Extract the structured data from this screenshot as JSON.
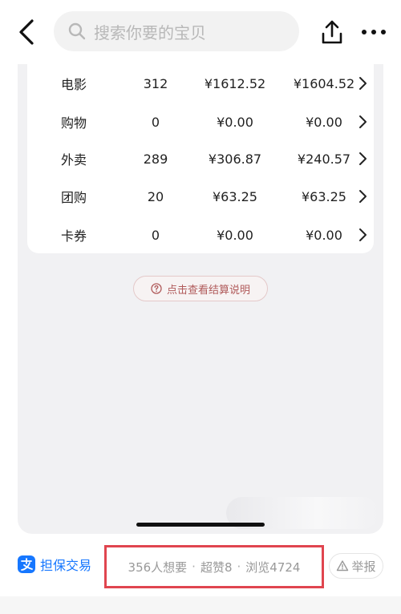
{
  "header": {
    "search_placeholder": "搜索你要的宝贝"
  },
  "table": {
    "rows": [
      {
        "name": "电影",
        "count": "312",
        "amount_a": "¥1612.52",
        "amount_b": "¥1604.52"
      },
      {
        "name": "购物",
        "count": "0",
        "amount_a": "¥0.00",
        "amount_b": "¥0.00"
      },
      {
        "name": "外卖",
        "count": "289",
        "amount_a": "¥306.87",
        "amount_b": "¥240.57"
      },
      {
        "name": "团购",
        "count": "20",
        "amount_a": "¥63.25",
        "amount_b": "¥63.25"
      },
      {
        "name": "卡券",
        "count": "0",
        "amount_a": "¥0.00",
        "amount_b": "¥0.00"
      }
    ]
  },
  "explain_link": "点击查看结算说明",
  "footer": {
    "escrow_label": "担保交易",
    "wants": "356人想要",
    "likes": "超赞8",
    "views": "浏览4724",
    "separator": "·",
    "report_label": "举报"
  },
  "colors": {
    "escrow_blue": "#1677ff",
    "highlight_red": "#e0454f",
    "explain_text": "#b05a5a"
  },
  "icons": {
    "back": "chevron-left-icon",
    "search": "search-icon",
    "share": "share-icon",
    "more": "more-dots-icon",
    "row_arrow": "chevron-right-icon",
    "question": "question-circle-icon",
    "alipay": "alipay-icon",
    "warning": "warning-icon"
  }
}
